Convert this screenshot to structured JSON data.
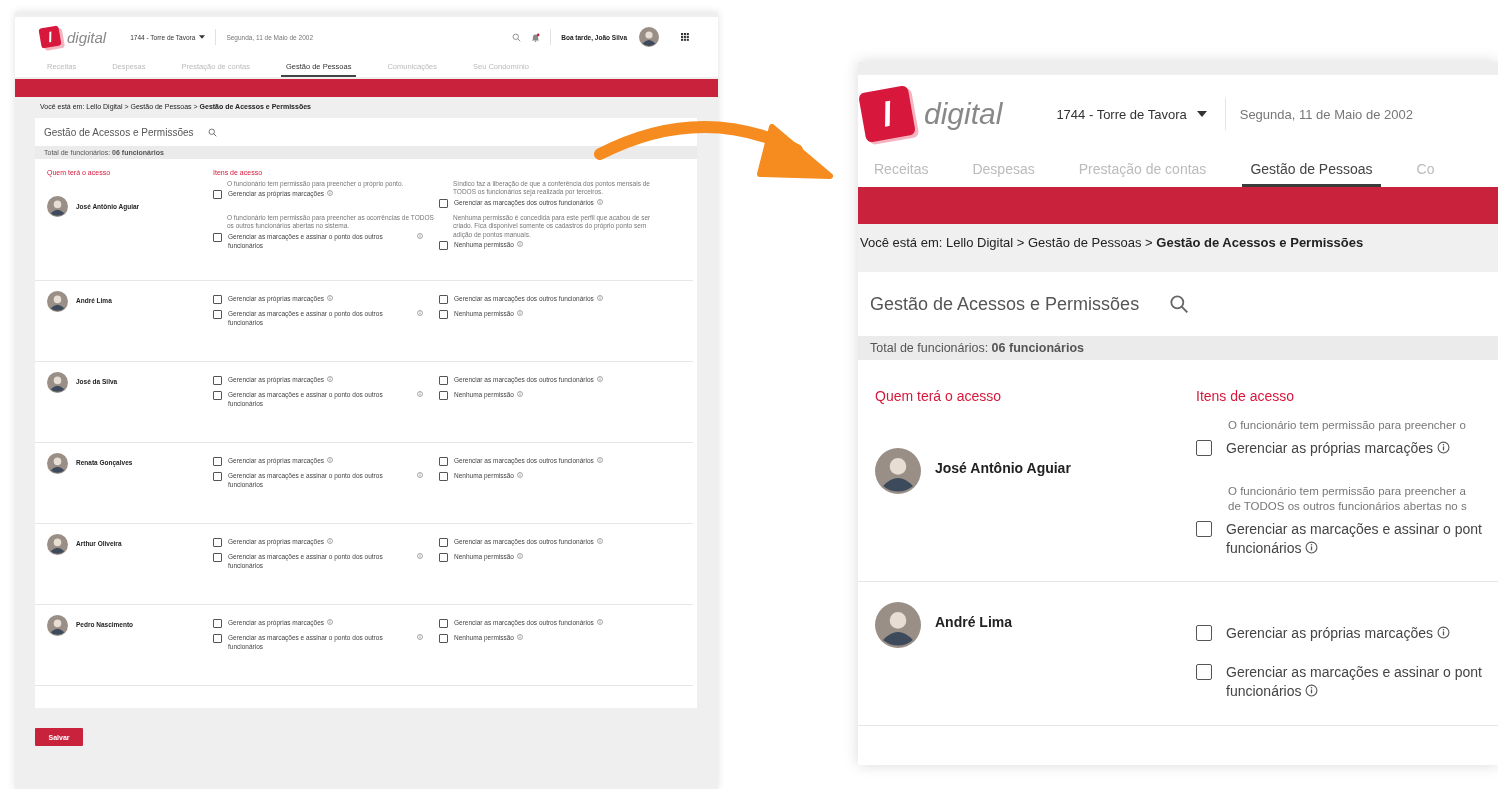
{
  "main_screen": {
    "header": {
      "logo_letter": "l",
      "logo_text": "digital",
      "condo": "1744 - Torre de Tavora",
      "date": "Segunda, 11 de Maio de 2002",
      "greeting": "Boa tarde, João Silva",
      "notification": true
    },
    "tabs": [
      {
        "label": "Receitas",
        "selected": false
      },
      {
        "label": "Despesas",
        "selected": false
      },
      {
        "label": "Prestação de contas",
        "selected": false
      },
      {
        "label": "Gestão de Pessoas",
        "selected": true
      },
      {
        "label": "Comunicações",
        "selected": false
      },
      {
        "label": "Seu Condomínio",
        "selected": false
      }
    ],
    "breadcrumb": "Você está em: Lello Digital > Gestão de Pessoas > **Gestão de Acessos e Permissões**",
    "card": {
      "title": "Gestão de Acessos e Permissões",
      "total": "Total de funcionários: **06 funcionários**",
      "columns": [
        "Quem terá o acesso",
        "Itens de acesso"
      ],
      "employees": [
        {
          "name": "José Antônio Aguiar",
          "options": [
            {
              "label": "Gerenciar as próprias marcações",
              "description": "O funcionário tem permissão para preencher o próprio ponto.",
              "checked": false
            },
            {
              "label": "Gerenciar as marcações dos outros funcionários",
              "description": "Síndico faz a liberação de que a conferência dos pontos mensais de TODOS os funcionários seja realizada por terceiros.",
              "checked": false
            },
            {
              "label": "Gerenciar as marcações e assinar o ponto dos outros funcionários",
              "description": "O funcionário tem permissão para preencher as ocorrências de TODOS os outros funcionários abertas no sistema.",
              "checked": false
            },
            {
              "label": "Nenhuma permissão",
              "description": "Nenhuma permissão é concedida para este perfil que acabou de ser criado. Fica disponível somente os cadastros do próprio ponto sem adição de pontos manuais.",
              "checked": false
            }
          ]
        },
        {
          "name": "André Lima",
          "options": [
            {
              "label": "Gerenciar as próprias marcações",
              "checked": false
            },
            {
              "label": "Gerenciar as marcações dos outros funcionários",
              "checked": false
            },
            {
              "label": "Gerenciar as marcações e assinar o ponto dos outros funcionários",
              "checked": false
            },
            {
              "label": "Nenhuma permissão",
              "checked": false
            }
          ]
        },
        {
          "name": "José da Silva",
          "options": [
            {
              "label": "Gerenciar as próprias marcações",
              "checked": false
            },
            {
              "label": "Gerenciar as marcações dos outros funcionários",
              "checked": false
            },
            {
              "label": "Gerenciar as marcações e assinar o ponto dos outros funcionários",
              "checked": false
            },
            {
              "label": "Nenhuma permissão",
              "checked": false
            }
          ]
        },
        {
          "name": "Renata Gonçalves",
          "options": [
            {
              "label": "Gerenciar as próprias marcações",
              "checked": false
            },
            {
              "label": "Gerenciar as marcações dos outros funcionários",
              "checked": false
            },
            {
              "label": "Gerenciar as marcações e assinar o ponto dos outros funcionários",
              "checked": false
            },
            {
              "label": "Nenhuma permissão",
              "checked": false
            }
          ]
        },
        {
          "name": "Arthur Oliveira",
          "options": [
            {
              "label": "Gerenciar as próprias marcações",
              "checked": false
            },
            {
              "label": "Gerenciar as marcações dos outros funcionários",
              "checked": false
            },
            {
              "label": "Gerenciar as marcações e assinar o ponto dos outros funcionários",
              "checked": false
            },
            {
              "label": "Nenhuma permissão",
              "checked": false
            }
          ]
        },
        {
          "name": "Pedro Nascimento",
          "options": [
            {
              "label": "Gerenciar as próprias marcações",
              "checked": false
            },
            {
              "label": "Gerenciar as marcações dos outros funcionários",
              "checked": false
            },
            {
              "label": "Gerenciar as marcações e assinar o ponto dos outros funcionários",
              "checked": false
            },
            {
              "label": "Nenhuma permissão",
              "checked": false
            }
          ]
        }
      ]
    },
    "save_button": "Salvar"
  },
  "zoomed_view": {
    "header": {
      "logo_letter": "l",
      "logo_text": "digital",
      "condo": "1744 - Torre de Tavora",
      "date": "Segunda, 11 de Maio de 2002"
    },
    "tabs": [
      {
        "label": "Receitas",
        "selected": false
      },
      {
        "label": "Despesas",
        "selected": false
      },
      {
        "label": "Prestação de contas",
        "selected": false
      },
      {
        "label": "Gestão de Pessoas",
        "selected": true
      },
      {
        "label": "Co",
        "selected": false
      }
    ],
    "breadcrumb": "Você está em: Lello Digital > Gestão de Pessoas > **Gestão de Acessos e Permissões**",
    "card": {
      "title": "Gestão de Acessos e Permissões",
      "total": "Total de funcionários: **06 funcionários**",
      "columns": [
        "Quem terá o acesso",
        "Itens de acesso"
      ],
      "employees": [
        {
          "name": "José Antônio Aguiar",
          "options": [
            {
              "label_lines": [
                "Gerenciar as próprias marcações"
              ],
              "description_lines": [
                "O funcionário tem permissão para preencher o"
              ],
              "checked": false
            },
            {
              "label_lines": [
                "Gerenciar as marcações e assinar o pont",
                "funcionários"
              ],
              "description_lines": [
                "O funcionário tem permissão para preencher a",
                "de TODOS os outros funcionários abertas no s"
              ],
              "checked": false
            }
          ]
        },
        {
          "name": "André Lima",
          "options": [
            {
              "label_lines": [
                "Gerenciar as próprias marcações"
              ],
              "checked": false
            },
            {
              "label_lines": [
                "Gerenciar as marcações e assinar o pont",
                "funcionários"
              ],
              "checked": false
            }
          ]
        }
      ]
    }
  }
}
